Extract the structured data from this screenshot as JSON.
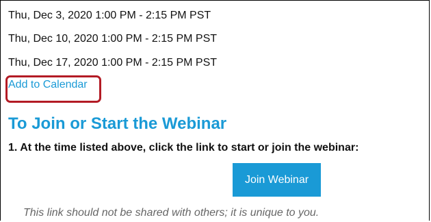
{
  "schedule": {
    "dates": [
      "Thu, Dec 3, 2020 1:00 PM - 2:15 PM PST",
      "Thu, Dec 10, 2020 1:00 PM - 2:15 PM PST",
      "Thu, Dec 17, 2020 1:00 PM - 2:15 PM PST"
    ],
    "add_to_calendar_label": "Add to Calendar"
  },
  "join_section": {
    "title": "To Join or Start the Webinar",
    "step_1": "1. At the time listed above, click the link to start or join the webinar:",
    "button_label": "Join Webinar",
    "note": "This link should not be shared with others; it is unique to you."
  },
  "colors": {
    "accent": "#1a9ad6",
    "highlight": "#b31b25",
    "text": "#111111",
    "muted": "#666666"
  }
}
